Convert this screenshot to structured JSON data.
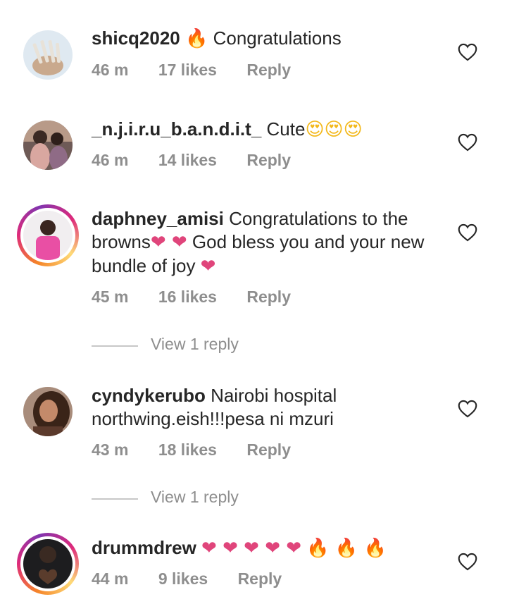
{
  "comments": [
    {
      "username": "shicq2020",
      "emoji_prefix": "🔥",
      "text": "Congratulations",
      "time": "46 m",
      "likes": "17 likes",
      "reply": "Reply",
      "avatar": "nails-photo",
      "story_ring": false
    },
    {
      "username": "_n.j.i.r.u_b.a.n.d.i.t_",
      "text": "Cute",
      "emoji_suffix": "😍😍😍",
      "time": "46 m",
      "likes": "14 likes",
      "reply": "Reply",
      "avatar": "two-women-photo",
      "story_ring": false
    },
    {
      "username": "daphney_amisi",
      "text_part1": "Congratulations to the browns",
      "emoji_mid": "❤ ❤",
      "text_part2": " God bless you and your new bundle of joy ",
      "emoji_end": "❤",
      "time": "45 m",
      "likes": "16 likes",
      "reply": "Reply",
      "view_replies": "View 1 reply",
      "avatar": "woman-pink-top-photo",
      "story_ring": true
    },
    {
      "username": "cyndykerubo",
      "text": "Nairobi hospital northwing.eish!!!pesa ni mzuri",
      "time": "43 m",
      "likes": "18 likes",
      "reply": "Reply",
      "view_replies": "View 1 reply",
      "avatar": "woman-portrait-photo",
      "story_ring": false
    },
    {
      "username": "drummdrew",
      "emoji_hearts": "❤ ❤ ❤ ❤ ❤",
      "emoji_fire": "🔥 🔥 🔥",
      "time": "44 m",
      "likes": "9 likes",
      "reply": "Reply",
      "avatar": "man-heart-hands-photo",
      "story_ring": true
    }
  ],
  "icons": {
    "like": "heart-outline-icon"
  },
  "colors": {
    "text": "#262626",
    "meta": "#8e8e8e",
    "heart_emoji": "#e0457b",
    "story_ring_start": "#f58529",
    "story_ring_end": "#dd2a7b"
  }
}
